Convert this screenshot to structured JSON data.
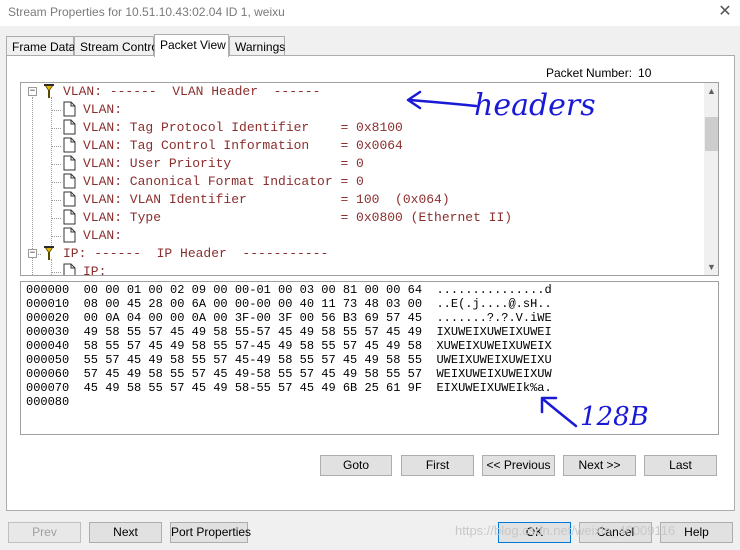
{
  "window": {
    "title": "Stream Properties for 10.51.10.43:02.04  ID 1, weixu",
    "close_glyph": "✕"
  },
  "tabs": [
    {
      "label": "Frame Data"
    },
    {
      "label": "Stream Control"
    },
    {
      "label": "Packet View",
      "active": true
    },
    {
      "label": "Warnings"
    }
  ],
  "packet_number": {
    "label": "Packet Number:",
    "value": "10"
  },
  "tree": {
    "rows": [
      {
        "text": "VLAN: ------  VLAN Header  ------",
        "kind": "group"
      },
      {
        "text": "VLAN:",
        "kind": "leaf"
      },
      {
        "text": "VLAN: Tag Protocol Identifier    = 0x8100",
        "kind": "leaf"
      },
      {
        "text": "VLAN: Tag Control Information    = 0x0064",
        "kind": "leaf"
      },
      {
        "text": "VLAN: User Priority              = 0",
        "kind": "leaf"
      },
      {
        "text": "VLAN: Canonical Format Indicator = 0",
        "kind": "leaf"
      },
      {
        "text": "VLAN: VLAN Identifier            = 100  (0x064)",
        "kind": "leaf"
      },
      {
        "text": "VLAN: Type                       = 0x0800 (Ethernet II)",
        "kind": "leaf"
      },
      {
        "text": "VLAN:",
        "kind": "leaf"
      },
      {
        "text": "IP: ------  IP Header  -----------",
        "kind": "group"
      },
      {
        "text": "IP:",
        "kind": "leaf"
      }
    ],
    "expander_glyph": "−",
    "scroll_up": "▲",
    "scroll_down": "▼"
  },
  "hex_dump": [
    "000000  00 00 01 00 02 09 00 00-01 00 03 00 81 00 00 64  ...............d",
    "000010  08 00 45 28 00 6A 00 00-00 00 40 11 73 48 03 00  ..E(.j....@.sH..",
    "000020  00 0A 04 00 00 0A 00 3F-00 3F 00 56 B3 69 57 45  .......?.?.V.iWE",
    "000030  49 58 55 57 45 49 58 55-57 45 49 58 55 57 45 49  IXUWEIXUWEIXUWEI",
    "000040  58 55 57 45 49 58 55 57-45 49 58 55 57 45 49 58  XUWEIXUWEIXUWEIX",
    "000050  55 57 45 49 58 55 57 45-49 58 55 57 45 49 58 55  UWEIXUWEIXUWEIXU",
    "000060  57 45 49 58 55 57 45 49-58 55 57 45 49 58 55 57  WEIXUWEIXUWEIXUW",
    "000070  45 49 58 55 57 45 49 58-55 57 45 49 6B 25 61 9F  EIXUWEIXUWEIk%a.",
    "000080"
  ],
  "nav_buttons": {
    "goto": "Goto",
    "first": "First",
    "previous": "<< Previous",
    "next": "Next >>",
    "last": "Last"
  },
  "bottom_buttons": {
    "prev": "Prev",
    "next": "Next",
    "port_properties": "Port Properties",
    "ok": "OK",
    "cancel": "Cancel",
    "help": "Help"
  },
  "annotations": {
    "headers": "headers",
    "size": "128B"
  },
  "watermark": "https://blog.csdn.net/weixin_40009116",
  "colors": {
    "tree_text": "#8b2e2e",
    "annotation_ink": "#1a1ad6",
    "focus_border": "#0078d7"
  }
}
